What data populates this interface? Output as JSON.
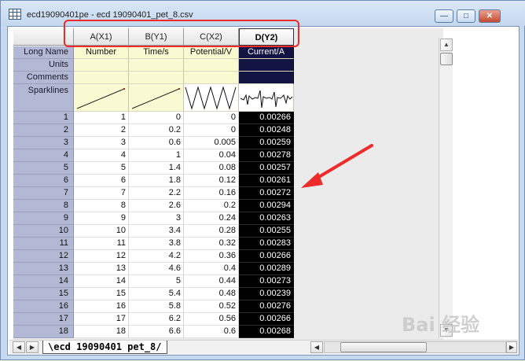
{
  "window": {
    "title": "ecd19090401pe - ecd 19090401_pet_8.csv",
    "minimize_glyph": "—",
    "maximize_glyph": "□",
    "close_glyph": "✕"
  },
  "columns": [
    {
      "header": "A(X1)",
      "long_name": "Number",
      "selected": false,
      "sparkline": "line-rising"
    },
    {
      "header": "B(Y1)",
      "long_name": "Time/s",
      "selected": false,
      "sparkline": "line-rising"
    },
    {
      "header": "C(X2)",
      "long_name": "Potential/V",
      "selected": false,
      "sparkline": "zigzag"
    },
    {
      "header": "D(Y2)",
      "long_name": "Current/A",
      "selected": true,
      "sparkline": "spiky"
    }
  ],
  "row_labels": {
    "long_name": "Long Name",
    "units": "Units",
    "comments": "Comments",
    "sparklines": "Sparklines"
  },
  "rows": [
    {
      "n": "1",
      "a": "1",
      "b": "0",
      "c": "0",
      "d": "0.00266"
    },
    {
      "n": "2",
      "a": "2",
      "b": "0.2",
      "c": "0",
      "d": "0.00248"
    },
    {
      "n": "3",
      "a": "3",
      "b": "0.6",
      "c": "0.005",
      "d": "0.00259"
    },
    {
      "n": "4",
      "a": "4",
      "b": "1",
      "c": "0.04",
      "d": "0.00278"
    },
    {
      "n": "5",
      "a": "5",
      "b": "1.4",
      "c": "0.08",
      "d": "0.00257"
    },
    {
      "n": "6",
      "a": "6",
      "b": "1.8",
      "c": "0.12",
      "d": "0.00261"
    },
    {
      "n": "7",
      "a": "7",
      "b": "2.2",
      "c": "0.16",
      "d": "0.00272"
    },
    {
      "n": "8",
      "a": "8",
      "b": "2.6",
      "c": "0.2",
      "d": "0.00294"
    },
    {
      "n": "9",
      "a": "9",
      "b": "3",
      "c": "0.24",
      "d": "0.00263"
    },
    {
      "n": "10",
      "a": "10",
      "b": "3.4",
      "c": "0.28",
      "d": "0.00255"
    },
    {
      "n": "11",
      "a": "11",
      "b": "3.8",
      "c": "0.32",
      "d": "0.00283"
    },
    {
      "n": "12",
      "a": "12",
      "b": "4.2",
      "c": "0.36",
      "d": "0.00266"
    },
    {
      "n": "13",
      "a": "13",
      "b": "4.6",
      "c": "0.4",
      "d": "0.00289"
    },
    {
      "n": "14",
      "a": "14",
      "b": "5",
      "c": "0.44",
      "d": "0.00273"
    },
    {
      "n": "15",
      "a": "15",
      "b": "5.4",
      "c": "0.48",
      "d": "0.00239"
    },
    {
      "n": "16",
      "a": "16",
      "b": "5.8",
      "c": "0.52",
      "d": "0.00276"
    },
    {
      "n": "17",
      "a": "17",
      "b": "6.2",
      "c": "0.56",
      "d": "0.00266"
    },
    {
      "n": "18",
      "a": "18",
      "b": "6.6",
      "c": "0.6",
      "d": "0.00268"
    }
  ],
  "sheet_tab": "\\ecd 19090401 pet_8/",
  "nav": {
    "prev": "◀",
    "next": "▶"
  },
  "scroll": {
    "up": "▲",
    "down": "▼"
  },
  "watermark": "Bai 经验",
  "annotations": {
    "box_color": "#ee2b2b",
    "arrow_color": "#ee2b2b"
  }
}
